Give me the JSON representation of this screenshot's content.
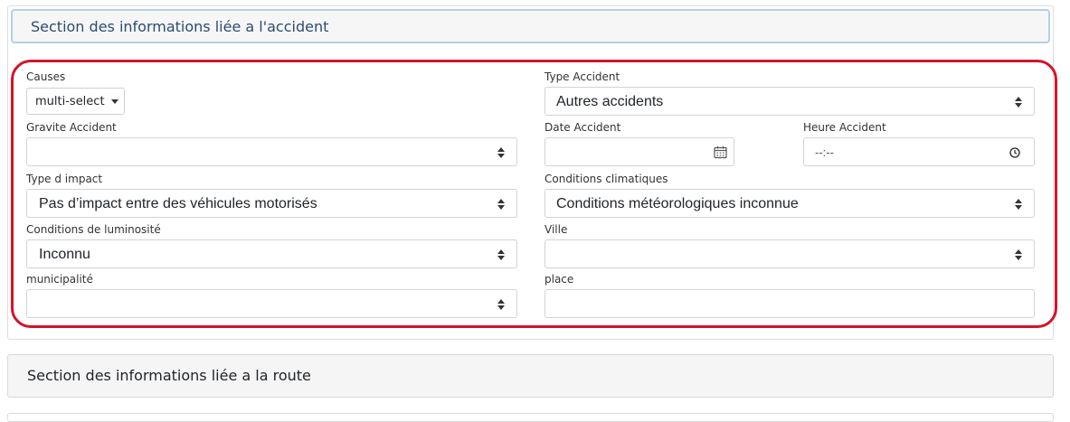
{
  "section_accident": {
    "title": "Section des informations liée a l'accident",
    "fields": {
      "causes": {
        "label": "Causes",
        "value": "multi-select"
      },
      "type_accident": {
        "label": "Type Accident",
        "value": "Autres accidents"
      },
      "gravite": {
        "label": "Gravite Accident",
        "value": ""
      },
      "date": {
        "label": "Date Accident",
        "value": ""
      },
      "heure": {
        "label": "Heure Accident",
        "value": "--:--"
      },
      "type_impact": {
        "label": "Type d impact",
        "value": "Pas d’impact entre des véhicules motorisés"
      },
      "conditions_climatiques": {
        "label": "Conditions climatiques",
        "value": "Conditions météorologiques inconnue"
      },
      "luminosite": {
        "label": "Conditions de luminosité",
        "value": "Inconnu"
      },
      "ville": {
        "label": "Ville",
        "value": ""
      },
      "municipalite": {
        "label": "municipalité",
        "value": ""
      },
      "place": {
        "label": "place",
        "value": ""
      }
    },
    "highlight_color": "#d2152a"
  },
  "section_route": {
    "title": "Section des informations liée a la route"
  },
  "icons": {
    "date": "calendar-icon",
    "time": "clock-icon",
    "select": "select-arrows-icon",
    "multiselect": "caret-down-icon"
  }
}
